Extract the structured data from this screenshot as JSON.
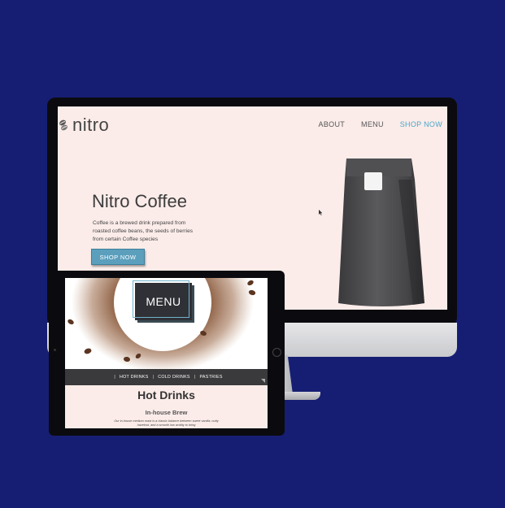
{
  "desktop": {
    "logo": {
      "text": "nitro"
    },
    "nav": [
      {
        "label": "ABOUT",
        "active": false
      },
      {
        "label": "MENU",
        "active": false
      },
      {
        "label": "SHOP NOW",
        "active": true
      }
    ],
    "hero": {
      "title": "Nitro Coffee",
      "description": "Coffee is a brewed drink prepared from roasted coffee beans, the seeds of berries from certain Coffee species",
      "button_label": "SHOP NOW"
    },
    "product_image": "coffee-bag-icon"
  },
  "tablet": {
    "hero_label": "MENU",
    "categories": [
      "HOT DRINKS",
      "COLD DRINKS",
      "PASTRIES"
    ],
    "section_title": "Hot Drinks",
    "subsection_title": "In-house Brew",
    "body": "Our in-house medium roast is a classic balance between sweet vanilla, nutty hazelnut, and a smooth low acidity to bring"
  },
  "colors": {
    "background": "#161e73",
    "page": "#fbece9",
    "accent": "#4ba6c8",
    "button": "#5b9fbd",
    "dark_bar": "#3a3a3c"
  }
}
